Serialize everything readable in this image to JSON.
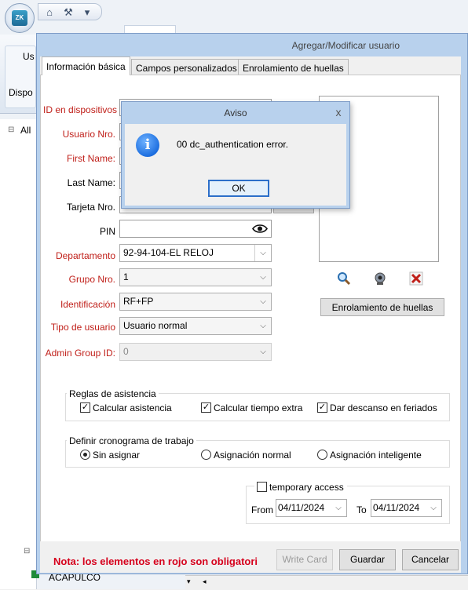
{
  "background": {
    "ribbon_label_1": "Us",
    "ribbon_label_2": "Dispo",
    "tree_root": "All",
    "tree_bottom_item": "ACAPULCO"
  },
  "dialog": {
    "title": "Agregar/Modificar usuario",
    "tabs": [
      "Información básica",
      "Campos personalizados",
      "Enrolamiento de huellas"
    ],
    "active_tab": "Información básica"
  },
  "form": {
    "id_label": "ID en dispositivos",
    "user_no_label": "Usuario Nro.",
    "first_name_label": "First Name:",
    "last_name_label": "Last Name:",
    "card_label": "Tarjeta Nro.",
    "pin_label": "PIN",
    "department_label": "Departamento",
    "department_value": "92-94-104-EL RELOJ",
    "group_label": "Grupo Nro.",
    "group_value": "1",
    "identification_label": "Identificación",
    "identification_value": "RF+FP",
    "user_type_label": "Tipo de usuario",
    "user_type_value": "Usuario normal",
    "admin_group_label": "Admin Group ID:",
    "admin_group_value": "0"
  },
  "photo": {
    "enroll_button": "Enrolamiento de huellas"
  },
  "attendance": {
    "title": "Reglas de asistencia",
    "options": [
      {
        "label": "Calcular asistencia",
        "checked": true
      },
      {
        "label": "Calcular tiempo extra",
        "checked": true
      },
      {
        "label": "Dar descanso en feriados",
        "checked": true
      }
    ]
  },
  "schedule": {
    "title": "Definir cronograma de trabajo",
    "options": [
      {
        "label": "Sin asignar",
        "selected": true
      },
      {
        "label": "Asignación normal",
        "selected": false
      },
      {
        "label": "Asignación inteligente",
        "selected": false
      }
    ]
  },
  "access": {
    "temporary_label": "temporary access",
    "temporary_checked": false,
    "from_label": "From",
    "from_value": "04/11/2024",
    "to_label": "To",
    "to_value": "04/11/2024"
  },
  "footer": {
    "note": "Nota: los elementos en rojo son obligatori",
    "write_card": "Write Card",
    "save": "Guardar",
    "cancel": "Cancelar"
  },
  "alert": {
    "title": "Aviso",
    "close": "x",
    "message": "00 dc_authentication error.",
    "ok": "OK"
  },
  "colors": {
    "required_label": "#c0201a",
    "note": "#d6001c",
    "window_frame": "#b8d1ed"
  }
}
